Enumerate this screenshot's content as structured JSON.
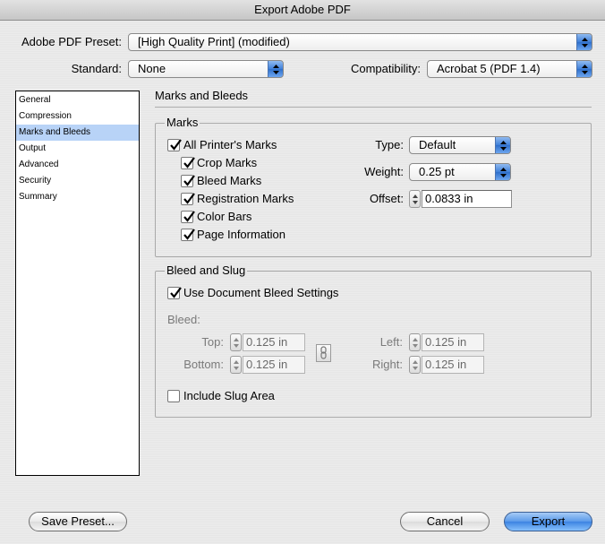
{
  "window": {
    "title": "Export Adobe PDF"
  },
  "top": {
    "preset_label": "Adobe PDF Preset:",
    "preset_value": "[High Quality Print] (modified)",
    "standard_label": "Standard:",
    "standard_value": "None",
    "compat_label": "Compatibility:",
    "compat_value": "Acrobat 5 (PDF 1.4)"
  },
  "sidebar": {
    "items": [
      {
        "label": "General"
      },
      {
        "label": "Compression"
      },
      {
        "label": "Marks and Bleeds"
      },
      {
        "label": "Output"
      },
      {
        "label": "Advanced"
      },
      {
        "label": "Security"
      },
      {
        "label": "Summary"
      }
    ],
    "selected": "Marks and Bleeds"
  },
  "panel": {
    "title": "Marks and Bleeds",
    "marks": {
      "title": "Marks",
      "all": {
        "label": "All Printer's Marks",
        "checked": true
      },
      "items": [
        {
          "label": "Crop Marks",
          "checked": true
        },
        {
          "label": "Bleed Marks",
          "checked": true
        },
        {
          "label": "Registration Marks",
          "checked": true
        },
        {
          "label": "Color Bars",
          "checked": true
        },
        {
          "label": "Page Information",
          "checked": true
        }
      ],
      "type_label": "Type:",
      "type_value": "Default",
      "weight_label": "Weight:",
      "weight_value": "0.25 pt",
      "offset_label": "Offset:",
      "offset_value": "0.0833 in"
    },
    "bleed": {
      "title": "Bleed and Slug",
      "use_doc": {
        "label": "Use Document Bleed Settings",
        "checked": true
      },
      "bleed_label": "Bleed:",
      "top_label": "Top:",
      "top_value": "0.125 in",
      "bottom_label": "Bottom:",
      "bottom_value": "0.125 in",
      "left_label": "Left:",
      "left_value": "0.125 in",
      "right_label": "Right:",
      "right_value": "0.125 in",
      "slug": {
        "label": "Include Slug Area",
        "checked": false
      }
    }
  },
  "buttons": {
    "save_preset": "Save Preset...",
    "cancel": "Cancel",
    "export": "Export"
  },
  "colors": {
    "accent": "#3c83e2",
    "selection": "#b8d3f7"
  }
}
